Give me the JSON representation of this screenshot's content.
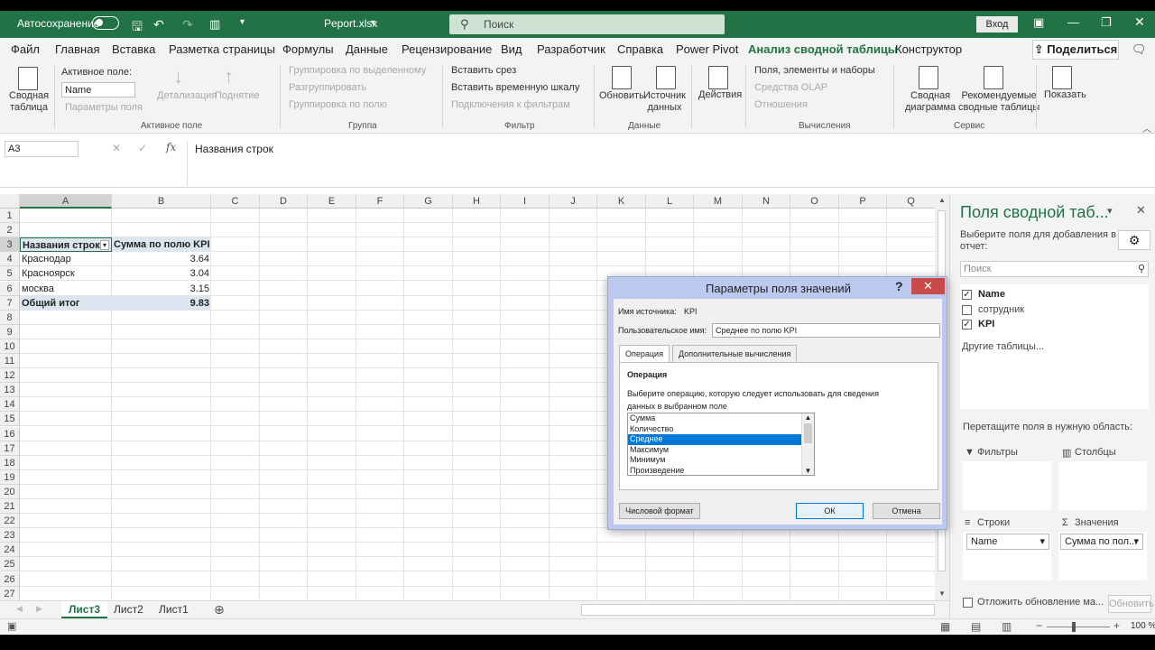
{
  "titlebar": {
    "autosave": "Автосохранение",
    "filename": "Peport.xlsx",
    "search_placeholder": "Поиск",
    "login": "Вход"
  },
  "menu": [
    "Файл",
    "Главная",
    "Вставка",
    "Разметка страницы",
    "Формулы",
    "Данные",
    "Рецензирование",
    "Вид",
    "Разработчик",
    "Справка",
    "Power Pivot",
    "Анализ сводной таблицы",
    "Конструктор"
  ],
  "share": "Поделиться",
  "ribbon": {
    "pivot_table": "Сводная\nтаблица",
    "active_field_label": "Активное поле:",
    "active_field_value": "Name",
    "field_params": "Параметры поля",
    "drill_down": "Детализация",
    "drill_up": "Поднятие",
    "group_active_field": "Активное поле",
    "group_selection": "Группировка по выделенному",
    "ungroup": "Разгруппировать",
    "group_field": "Группировка по полю",
    "group_group": "Группа",
    "insert_slicer": "Вставить срез",
    "insert_timeline": "Вставить временную шкалу",
    "filter_connections": "Подключения к фильтрам",
    "group_filter": "Фильтр",
    "refresh": "Обновить",
    "data_source": "Источник\nданных",
    "group_data": "Данные",
    "actions": "Действия",
    "fields_items_sets": "Поля, элементы и наборы",
    "olap_tools": "Средства OLAP",
    "relationships": "Отношения",
    "group_calculations": "Вычисления",
    "pivot_chart": "Сводная\nдиаграмма",
    "recommended": "Рекомендуемые\nсводные таблицы",
    "group_service": "Сервис",
    "show": "Показать"
  },
  "formula": {
    "namebox": "A3",
    "content": "Названия строк"
  },
  "columns": [
    "A",
    "B",
    "C",
    "D",
    "E",
    "F",
    "G",
    "H",
    "I",
    "J",
    "K",
    "L",
    "M",
    "N",
    "O",
    "P",
    "Q"
  ],
  "rows": [
    "1",
    "2",
    "3",
    "4",
    "5",
    "6",
    "7",
    "8",
    "9",
    "10",
    "11",
    "12",
    "13",
    "14",
    "15",
    "16",
    "17",
    "18",
    "19",
    "20",
    "21",
    "22",
    "23",
    "24",
    "25",
    "26",
    "27"
  ],
  "pivot": {
    "header_rows": "Названия строк",
    "header_values": "Сумма по полю KPI",
    "items": [
      {
        "name": "Краснодар",
        "value": "3.64"
      },
      {
        "name": "Красноярск",
        "value": "3.04"
      },
      {
        "name": "москва",
        "value": "3.15"
      }
    ],
    "total_label": "Общий итог",
    "total_value": "9.83"
  },
  "sheets": [
    "Лист3",
    "Лист2",
    "Лист1"
  ],
  "status": {
    "zoom": "100 %"
  },
  "pane": {
    "title": "Поля сводной таб...",
    "choose": "Выберите поля для добавления в отчет:",
    "search_placeholder": "Поиск",
    "fields": [
      {
        "name": "Name",
        "checked": true
      },
      {
        "name": "сотрудник",
        "checked": false
      },
      {
        "name": "KPI",
        "checked": true
      }
    ],
    "other_tables": "Другие таблицы...",
    "drag_hint": "Перетащите поля в нужную область:",
    "filters": "Фильтры",
    "columns": "Столбцы",
    "rows": "Строки",
    "values": "Значения",
    "rows_value": "Name",
    "values_value": "Сумма по пол...",
    "defer": "Отложить обновление ма...",
    "update": "Обновить"
  },
  "dialog": {
    "title": "Параметры поля значений",
    "source_label": "Имя источника:",
    "source_value": "KPI",
    "custom_label": "Пользовательское имя:",
    "custom_value": "Среднее по полю KPI",
    "tab_operation": "Операция",
    "tab_extra": "Дополнительные вычисления",
    "section": "Операция",
    "hint": "Выберите операцию, которую следует использовать для сведения данных в выбранном поле",
    "options": [
      "Сумма",
      "Количество",
      "Среднее",
      "Максимум",
      "Минимум",
      "Произведение"
    ],
    "selected": "Среднее",
    "number_format": "Числовой формат",
    "ok": "ОК",
    "cancel": "Отмена"
  }
}
